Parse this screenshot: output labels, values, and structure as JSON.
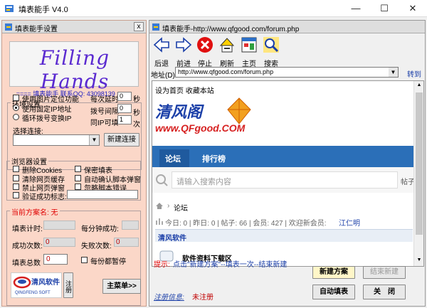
{
  "window": {
    "title": "填表能手 V4.0",
    "min": "—",
    "max": "☐",
    "close": "✕"
  },
  "left": {
    "title": "填表能手设置",
    "close": "x",
    "logo": "Filling Hands",
    "contact": "==== 填表能手 联系QQ: 43098139 ====",
    "env": {
      "title": "环境设置",
      "opt1": "使用图片定位功能",
      "opt2": "使用固定IP地址",
      "opt3": "循环拨号变换IP",
      "delay_label": "每次延时",
      "delay_val": "0",
      "delay_unit": "秒",
      "dial_label": "拨号间隔",
      "dial_val": "0",
      "dial_unit": "秒",
      "ip_label": "同IP可填",
      "ip_val": "1",
      "ip_unit": "次",
      "conn_label": "选择连接:",
      "new_conn": "新建连接"
    },
    "browser": {
      "title": "浏览器设置",
      "c1": "删除Cookies",
      "c2": "保密填表",
      "c3": "清除网页缓存",
      "c4": "自动确认脚本弹窗",
      "c5": "禁止网页弹窗",
      "c6": "忽略脚本错误",
      "c7": "验证成功标志:"
    },
    "scheme": {
      "title": "当前方案名: 无",
      "timer": "填表计时:",
      "per_min": "每分钟成功:",
      "succ": "成功次数:",
      "succ_val": "0",
      "fail": "失败次数:",
      "fail_val": "0",
      "total": "填表总数",
      "total_val": "0",
      "pause": "每份都暂停"
    },
    "brand": "清风软件",
    "brand_en": "QINGFENG SOFT",
    "register": "注册",
    "mainmenu": "主菜单>>"
  },
  "right": {
    "title": "填表能手-http://www.qfgood.com/forum.php",
    "toolbar": [
      "后退",
      "前进",
      "停止",
      "刷新",
      "主页",
      "搜索"
    ],
    "addr_label": "地址(D)",
    "addr_val": "http://www.qfgood.com/forum.php",
    "go": "转到",
    "web": {
      "links": "设为首页   收藏本站",
      "site_cn": "清风阁",
      "site_url": "www.QFgood.COM",
      "nav1": "论坛",
      "nav2": "排行榜",
      "search_ph": "请输入搜索内容",
      "search_suffix": "帖子",
      "crumb": "论坛",
      "stats": "今日: 0 | 昨日: 0 | 帖子: 66 | 会员: 427 | 欢迎新会员: ",
      "newest": "江仁明",
      "section": "清风软件",
      "forum": "软件资料下载区"
    },
    "hint_label": "提示:",
    "hint": "点击\"新建方案\"--填表一次--结束新建",
    "reg_label": "注册信息:",
    "reg_val": "未注册",
    "btn_new": "新建方案",
    "btn_end": "结束新建",
    "btn_auto": "自动填表",
    "btn_close": "关　闭"
  }
}
